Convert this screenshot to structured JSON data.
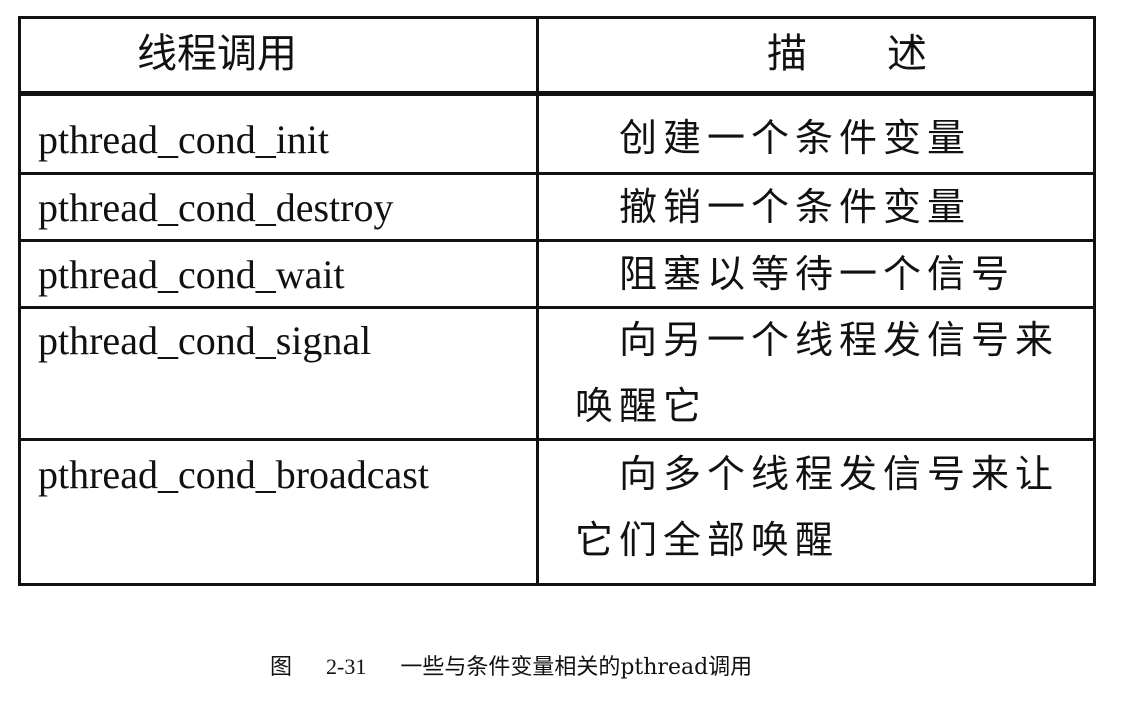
{
  "table": {
    "headers": [
      "线程调用",
      "描　　述"
    ],
    "rows": [
      {
        "call": "pthread_cond_init",
        "description": "创建一个条件变量"
      },
      {
        "call": "pthread_cond_destroy",
        "description": "撤销一个条件变量"
      },
      {
        "call": "pthread_cond_wait",
        "description": "阻塞以等待一个信号"
      },
      {
        "call": "pthread_cond_signal",
        "description": "向另一个线程发信号来唤醒它"
      },
      {
        "call": "pthread_cond_broadcast",
        "description": "向多个线程发信号来让它们全部唤醒"
      }
    ]
  },
  "caption": {
    "label": "图",
    "number": "2-31",
    "text": "一些与条件变量相关的pthread调用"
  }
}
